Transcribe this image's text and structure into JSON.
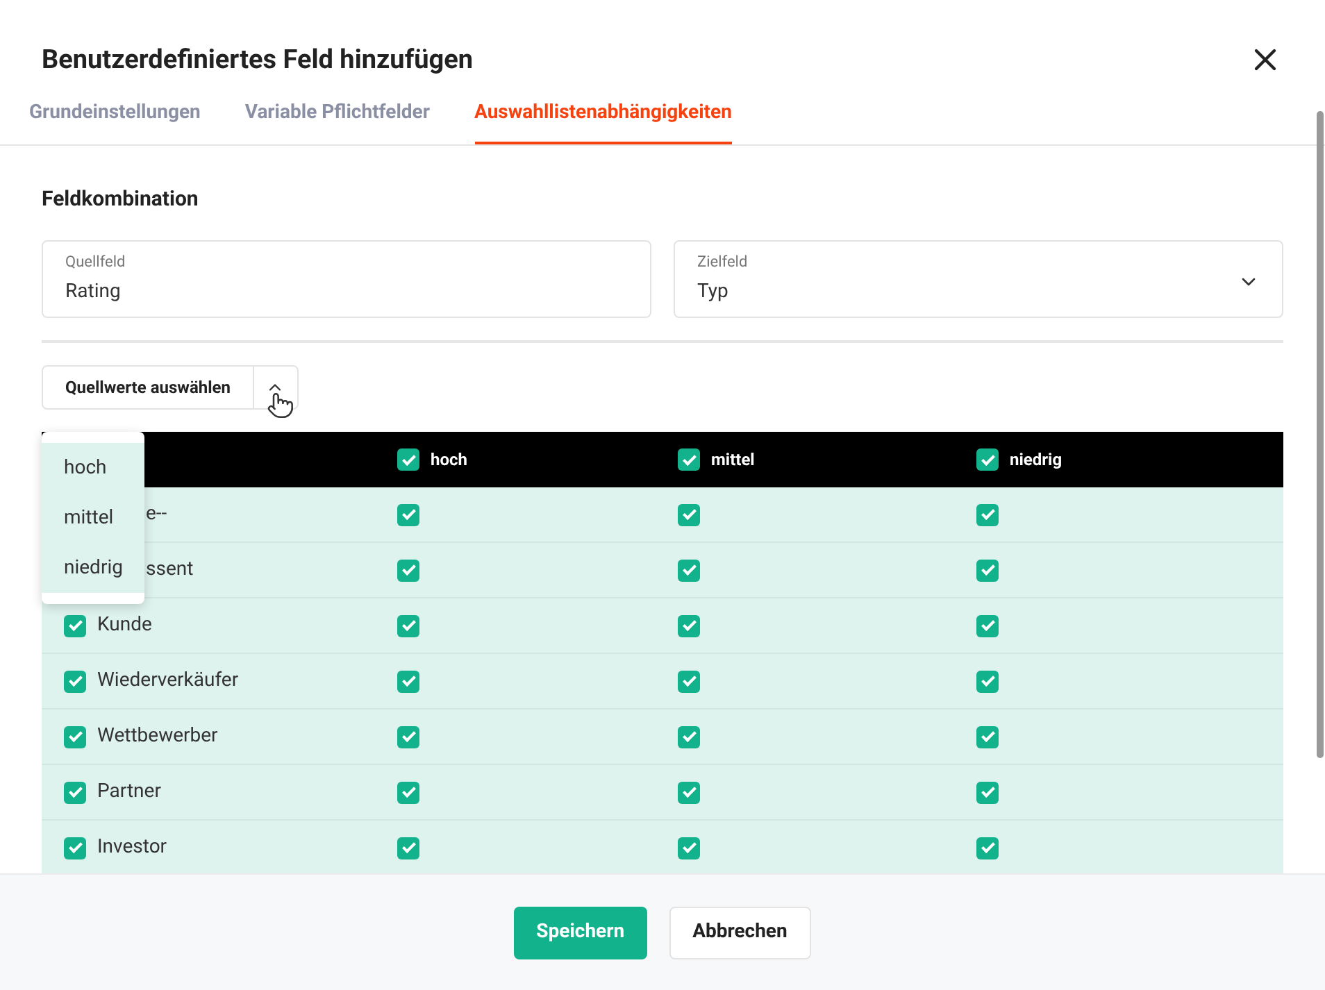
{
  "title": "Benutzerdefiniertes Feld hinzufügen",
  "tabs": [
    {
      "label": "Grundeinstellungen",
      "selected": false
    },
    {
      "label": "Variable Pflichtfelder",
      "selected": false
    },
    {
      "label": "Auswahllistenabhängigkeiten",
      "selected": true
    }
  ],
  "section_title": "Feldkombination",
  "source_field": {
    "label": "Quellfeld",
    "value": "Rating"
  },
  "target_field": {
    "label": "Zielfeld",
    "value": "Typ"
  },
  "source_values_button": {
    "label": "Quellwerte auswählen",
    "expanded": true
  },
  "dropdown": [
    "hoch",
    "mittel",
    "niedrig"
  ],
  "table": {
    "columns": [
      {
        "label": "hoch",
        "checked": true
      },
      {
        "label": "mittel",
        "checked": true
      },
      {
        "label": "niedrig",
        "checked": true
      }
    ],
    "rows": [
      {
        "kind": "covered",
        "label": "e--",
        "cells": [
          true,
          true,
          true
        ]
      },
      {
        "kind": "covered",
        "label": "ssent",
        "cells": [
          true,
          true,
          true
        ]
      },
      {
        "kind": "full",
        "label": "Kunde",
        "checked": true,
        "cells": [
          true,
          true,
          true
        ]
      },
      {
        "kind": "full",
        "label": "Wiederverkäufer",
        "checked": true,
        "cells": [
          true,
          true,
          true
        ]
      },
      {
        "kind": "full",
        "label": "Wettbewerber",
        "checked": true,
        "cells": [
          true,
          true,
          true
        ]
      },
      {
        "kind": "full",
        "label": "Partner",
        "checked": true,
        "cells": [
          true,
          true,
          true
        ]
      },
      {
        "kind": "full",
        "label": "Investor",
        "checked": true,
        "cells": [
          true,
          true,
          true
        ]
      }
    ]
  },
  "buttons": {
    "save": "Speichern",
    "cancel": "Abbrechen"
  }
}
